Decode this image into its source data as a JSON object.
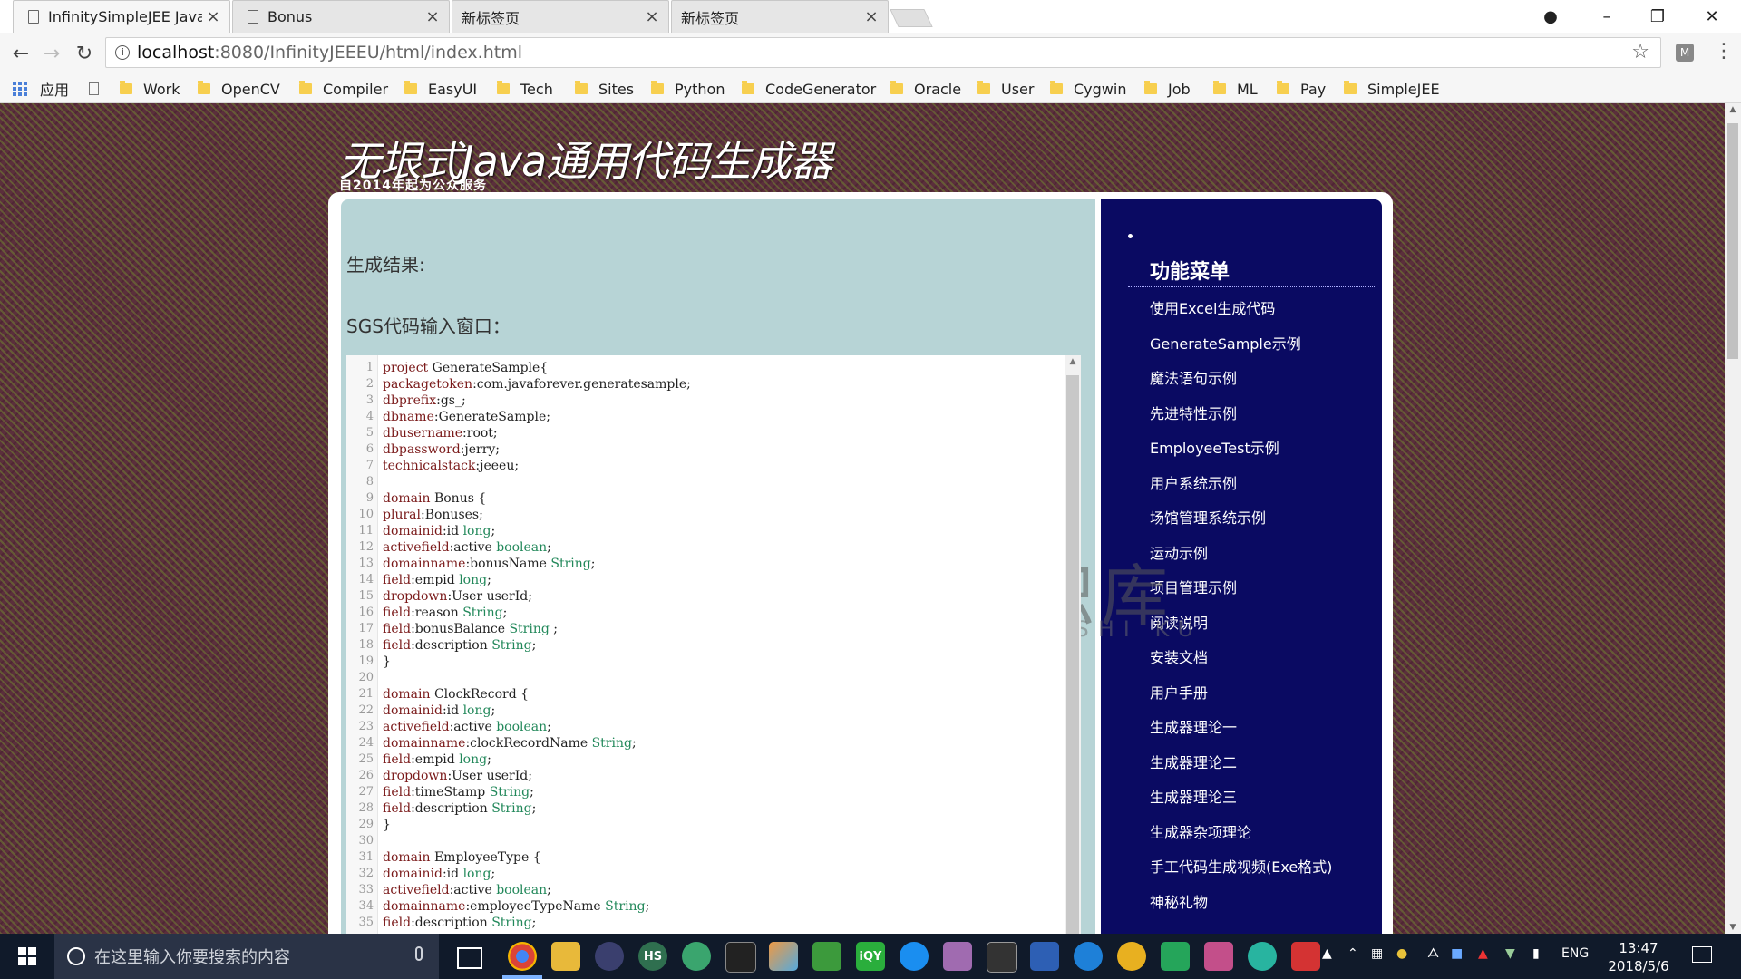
{
  "browser": {
    "tabs": [
      {
        "title": "InfinitySimpleJEE Java C",
        "close": "×",
        "active": true
      },
      {
        "title": "Bonus",
        "close": "×",
        "active": false
      },
      {
        "title": "新标签页",
        "close": "×",
        "active": false
      },
      {
        "title": "新标签页",
        "close": "×",
        "active": false
      }
    ],
    "address": {
      "host": "localhost",
      "path": ":8080/InfinityJEEEU/html/index.html"
    },
    "bookmarks": [
      "应用",
      "Work",
      "OpenCV",
      "Compiler",
      "EasyUI",
      "Tech",
      "Sites",
      "Python",
      "CodeGenerator",
      "Oracle",
      "User",
      "Cygwin",
      "Job",
      "ML",
      "Pay",
      "SimpleJEE"
    ]
  },
  "page": {
    "title": "无垠式Java通用代码生成器",
    "subtitle": "自2014年起为公众服务",
    "result_label": "生成结果:",
    "sgs_label": "SGS代码输入窗口：",
    "watermark": {
      "text": "小牛知识库",
      "sub": "XIAO NIU ZHI SHI KU"
    },
    "editor": {
      "lines": [
        [
          [
            "kw",
            "project"
          ],
          [
            "pl",
            " GenerateSample{"
          ]
        ],
        [
          [
            "kw",
            "packagetoken"
          ],
          [
            "pl",
            ":com.javaforever.generatesample;"
          ]
        ],
        [
          [
            "kw",
            "dbprefix"
          ],
          [
            "pl",
            ":gs_;"
          ]
        ],
        [
          [
            "kw",
            "dbname"
          ],
          [
            "pl",
            ":GenerateSample;"
          ]
        ],
        [
          [
            "kw",
            "dbusername"
          ],
          [
            "pl",
            ":root;"
          ]
        ],
        [
          [
            "kw",
            "dbpassword"
          ],
          [
            "pl",
            ":jerry;"
          ]
        ],
        [
          [
            "kw",
            "technicalstack"
          ],
          [
            "pl",
            ":jeeeu;"
          ]
        ],
        [],
        [
          [
            "kw",
            "domain"
          ],
          [
            "pl",
            " Bonus {"
          ]
        ],
        [
          [
            "kw",
            "plural"
          ],
          [
            "pl",
            ":Bonuses;"
          ]
        ],
        [
          [
            "kw",
            "domainid"
          ],
          [
            "pl",
            ":id "
          ],
          [
            "ty",
            "long"
          ],
          [
            "pl",
            ";"
          ]
        ],
        [
          [
            "kw",
            "activefield"
          ],
          [
            "pl",
            ":active "
          ],
          [
            "ty",
            "boolean"
          ],
          [
            "pl",
            ";"
          ]
        ],
        [
          [
            "kw",
            "domainname"
          ],
          [
            "pl",
            ":bonusName "
          ],
          [
            "ty",
            "String"
          ],
          [
            "pl",
            ";"
          ]
        ],
        [
          [
            "kw",
            "field"
          ],
          [
            "pl",
            ":empid "
          ],
          [
            "ty",
            "long"
          ],
          [
            "pl",
            ";"
          ]
        ],
        [
          [
            "kw",
            "dropdown"
          ],
          [
            "pl",
            ":User userId;"
          ]
        ],
        [
          [
            "kw",
            "field"
          ],
          [
            "pl",
            ":reason "
          ],
          [
            "ty",
            "String"
          ],
          [
            "pl",
            ";"
          ]
        ],
        [
          [
            "kw",
            "field"
          ],
          [
            "pl",
            ":bonusBalance "
          ],
          [
            "ty",
            "String"
          ],
          [
            "pl",
            " ;"
          ]
        ],
        [
          [
            "kw",
            "field"
          ],
          [
            "pl",
            ":description "
          ],
          [
            "ty",
            "String"
          ],
          [
            "pl",
            ";"
          ]
        ],
        [
          [
            "pl",
            "}"
          ]
        ],
        [],
        [
          [
            "kw",
            "domain"
          ],
          [
            "pl",
            " ClockRecord {"
          ]
        ],
        [
          [
            "kw",
            "domainid"
          ],
          [
            "pl",
            ":id "
          ],
          [
            "ty",
            "long"
          ],
          [
            "pl",
            ";"
          ]
        ],
        [
          [
            "kw",
            "activefield"
          ],
          [
            "pl",
            ":active "
          ],
          [
            "ty",
            "boolean"
          ],
          [
            "pl",
            ";"
          ]
        ],
        [
          [
            "kw",
            "domainname"
          ],
          [
            "pl",
            ":clockRecordName "
          ],
          [
            "ty",
            "String"
          ],
          [
            "pl",
            ";"
          ]
        ],
        [
          [
            "kw",
            "field"
          ],
          [
            "pl",
            ":empid "
          ],
          [
            "ty",
            "long"
          ],
          [
            "pl",
            ";"
          ]
        ],
        [
          [
            "kw",
            "dropdown"
          ],
          [
            "pl",
            ":User userId;"
          ]
        ],
        [
          [
            "kw",
            "field"
          ],
          [
            "pl",
            ":timeStamp "
          ],
          [
            "ty",
            "String"
          ],
          [
            "pl",
            ";"
          ]
        ],
        [
          [
            "kw",
            "field"
          ],
          [
            "pl",
            ":description "
          ],
          [
            "ty",
            "String"
          ],
          [
            "pl",
            ";"
          ]
        ],
        [
          [
            "pl",
            "}"
          ]
        ],
        [],
        [
          [
            "kw",
            "domain"
          ],
          [
            "pl",
            " EmployeeType {"
          ]
        ],
        [
          [
            "kw",
            "domainid"
          ],
          [
            "pl",
            ":id "
          ],
          [
            "ty",
            "long"
          ],
          [
            "pl",
            ";"
          ]
        ],
        [
          [
            "kw",
            "activefield"
          ],
          [
            "pl",
            ":active "
          ],
          [
            "ty",
            "boolean"
          ],
          [
            "pl",
            ";"
          ]
        ],
        [
          [
            "kw",
            "domainname"
          ],
          [
            "pl",
            ":employeeTypeName "
          ],
          [
            "ty",
            "String"
          ],
          [
            "pl",
            ";"
          ]
        ],
        [
          [
            "kw",
            "field"
          ],
          [
            "pl",
            ":description "
          ],
          [
            "ty",
            "String"
          ],
          [
            "pl",
            ";"
          ]
        ]
      ]
    },
    "menu": {
      "title": "功能菜单",
      "items": [
        "使用Excel生成代码",
        "GenerateSample示例",
        "魔法语句示例",
        "先进特性示例",
        "EmployeeTest示例",
        "用户系统示例",
        "场馆管理系统示例",
        "运动示例",
        "项目管理示例",
        "阅读说明",
        "安装文档",
        "用户手册",
        "生成器理论一",
        "生成器理论二",
        "生成器理论三",
        "生成器杂项理论",
        "手工代码生成视频(Exe格式)",
        "神秘礼物"
      ]
    }
  },
  "taskbar": {
    "search_placeholder": "在这里输入你要搜索的内容",
    "lang": "ENG",
    "time": "13:47",
    "date": "2018/5/6"
  }
}
